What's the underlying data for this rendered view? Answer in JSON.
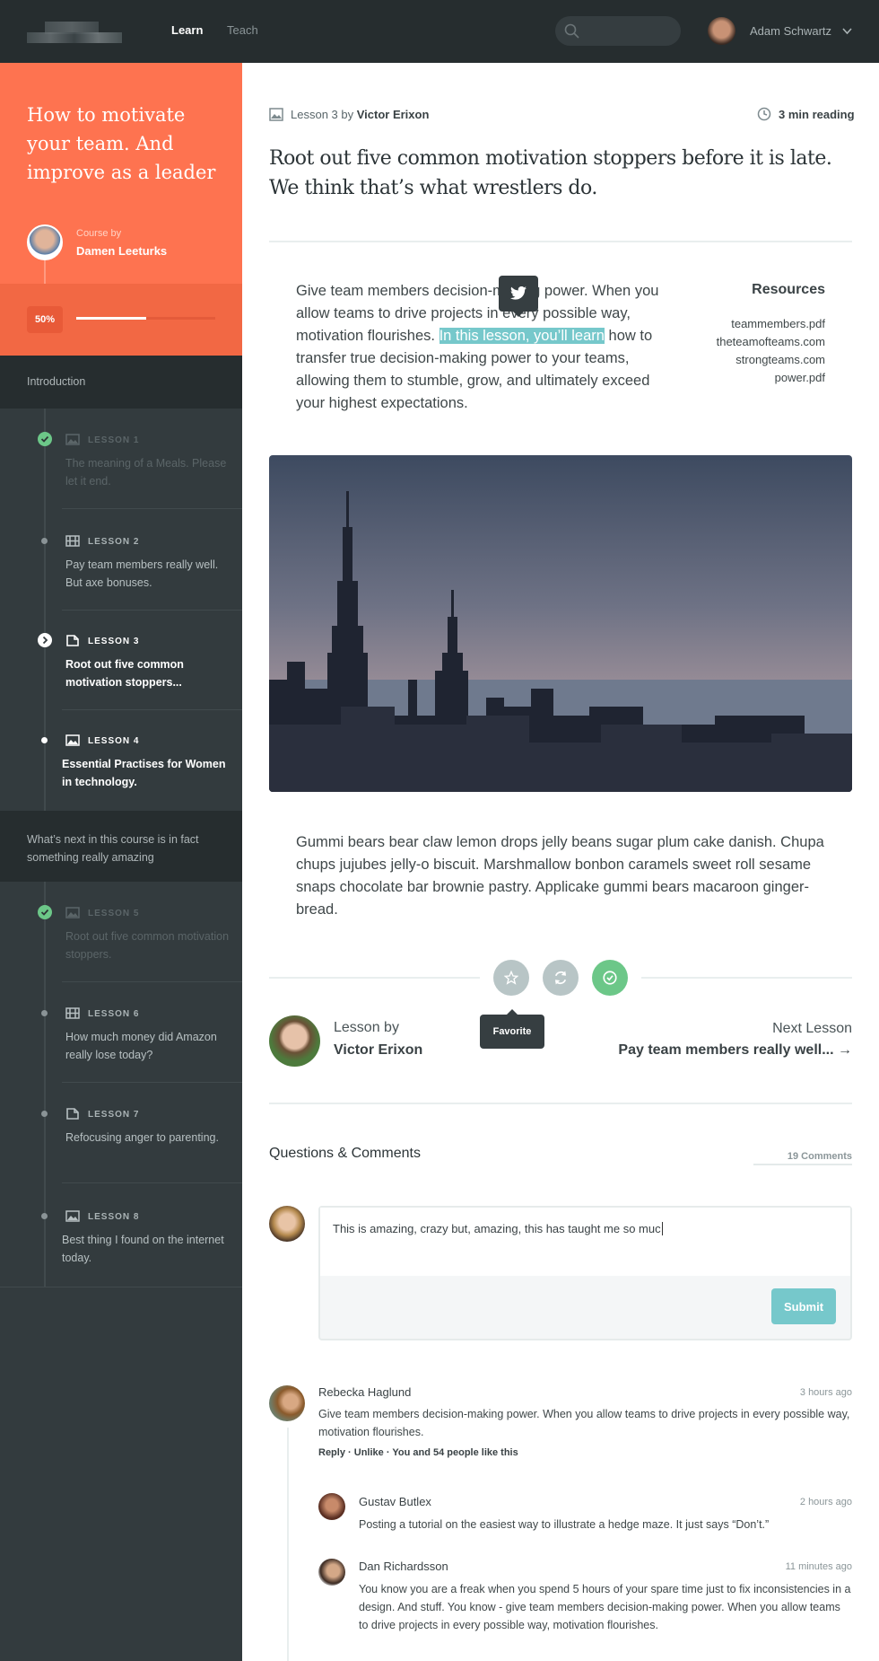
{
  "topbar": {
    "nav": [
      {
        "label": "Learn",
        "active": true
      },
      {
        "label": "Teach",
        "active": false
      }
    ],
    "search_placeholder": "",
    "user_name": "Adam Schwartz"
  },
  "sidebar": {
    "course_title": "How to motivate your team. And improve as a leader",
    "course_by_label": "Course by",
    "author": "Damen Leeturks",
    "progress_label": "50%",
    "progress": 0.5,
    "sections": [
      {
        "title": "Introduction",
        "lessons": [
          {
            "label": "LESSON 1",
            "title": "The meaning of a Meals. Please let it end.",
            "type": "image",
            "status": "done"
          },
          {
            "label": "LESSON 2",
            "title": "Pay team members really well. But axe bonuses.",
            "type": "video",
            "status": "todo"
          },
          {
            "label": "LESSON 3",
            "title": "Root out five common motivation stoppers...",
            "type": "document",
            "status": "current"
          },
          {
            "label": "LESSON 4",
            "title": "Essential Practises for Women in technology.",
            "type": "image",
            "status": "next"
          }
        ]
      },
      {
        "title": "What’s next in this course is in fact something really amazing",
        "lessons": [
          {
            "label": "LESSON 5",
            "title": "Root out five common motivation stoppers.",
            "type": "image",
            "status": "done"
          },
          {
            "label": "LESSON 6",
            "title": "How much money did Amazon really lose today?",
            "type": "video",
            "status": "todo"
          },
          {
            "label": "LESSON 7",
            "title": "Refocusing anger to parenting.",
            "type": "document",
            "status": "todo"
          },
          {
            "label": "LESSON 8",
            "title": "Best thing I found on the internet today.",
            "type": "image",
            "status": "todo"
          }
        ]
      }
    ]
  },
  "lesson": {
    "meta_prefix": "Lesson 3 by",
    "meta_author": "Victor Erixon",
    "reading_time": "3 min reading",
    "title": "Root out five common motivation stoppers before it is late. We think that’s what wrestlers do.",
    "para1_a": "Give team members decision-making power. When you allow teams to drive projects in every possible way, motivation flourishes. ",
    "para1_highlight": "In this lesson, you’ll learn",
    "para1_b": " how to transfer true decision-making power to your teams, allowing them to stumble, grow, and ultimately exceed your highest expectations.",
    "resources_title": "Resources",
    "resources": [
      "teammembers.pdf",
      "theteamofteams.com",
      "strongteams.com",
      "power.pdf"
    ],
    "para2": "Gummi bears bear claw lemon drops jelly beans sugar plum cake danish. Chupa chups jujubes jelly-o biscuit. Marshmallow bonbon caramels sweet roll sesame snaps chocolate bar brownie pastry. Applicake gummi bears macaroon ginger-bread.",
    "favorite_tooltip": "Favorite",
    "lesson_by_label": "Lesson by",
    "lesson_by_name": "Victor Erixon",
    "next_label": "Next Lesson",
    "next_title": "Pay team members really well...",
    "colors": {
      "accent": "#fe7350",
      "highlight": "#76c8cb",
      "done": "#6cc788"
    }
  },
  "comments": {
    "title": "Questions & Comments",
    "count_label": "19 Comments",
    "input_value": "This is amazing, crazy but, amazing, this has taught me so muc",
    "submit_label": "Submit",
    "items": [
      {
        "name": "Rebecka Haglund",
        "time": "3 hours ago",
        "body": "Give team members decision-making power. When you allow teams to drive projects in every possible way, motivation flourishes.",
        "reply": "Reply",
        "unlike": "Unlike",
        "likes": "You and 54 people like this"
      },
      {
        "name": "Gustav Butlex",
        "time": "2 hours ago",
        "body": "Posting a tutorial on the easiest way to illustrate a hedge maze. It just says “Don’t.”"
      },
      {
        "name": "Dan Richardsson",
        "time": "11 minutes ago",
        "body": "You know you are a freak when you spend 5 hours of your spare time just to fix inconsistencies in a design. And stuff. You know - give team members decision-making power. When you allow teams to drive projects in every possible way, motivation flourishes."
      }
    ]
  }
}
